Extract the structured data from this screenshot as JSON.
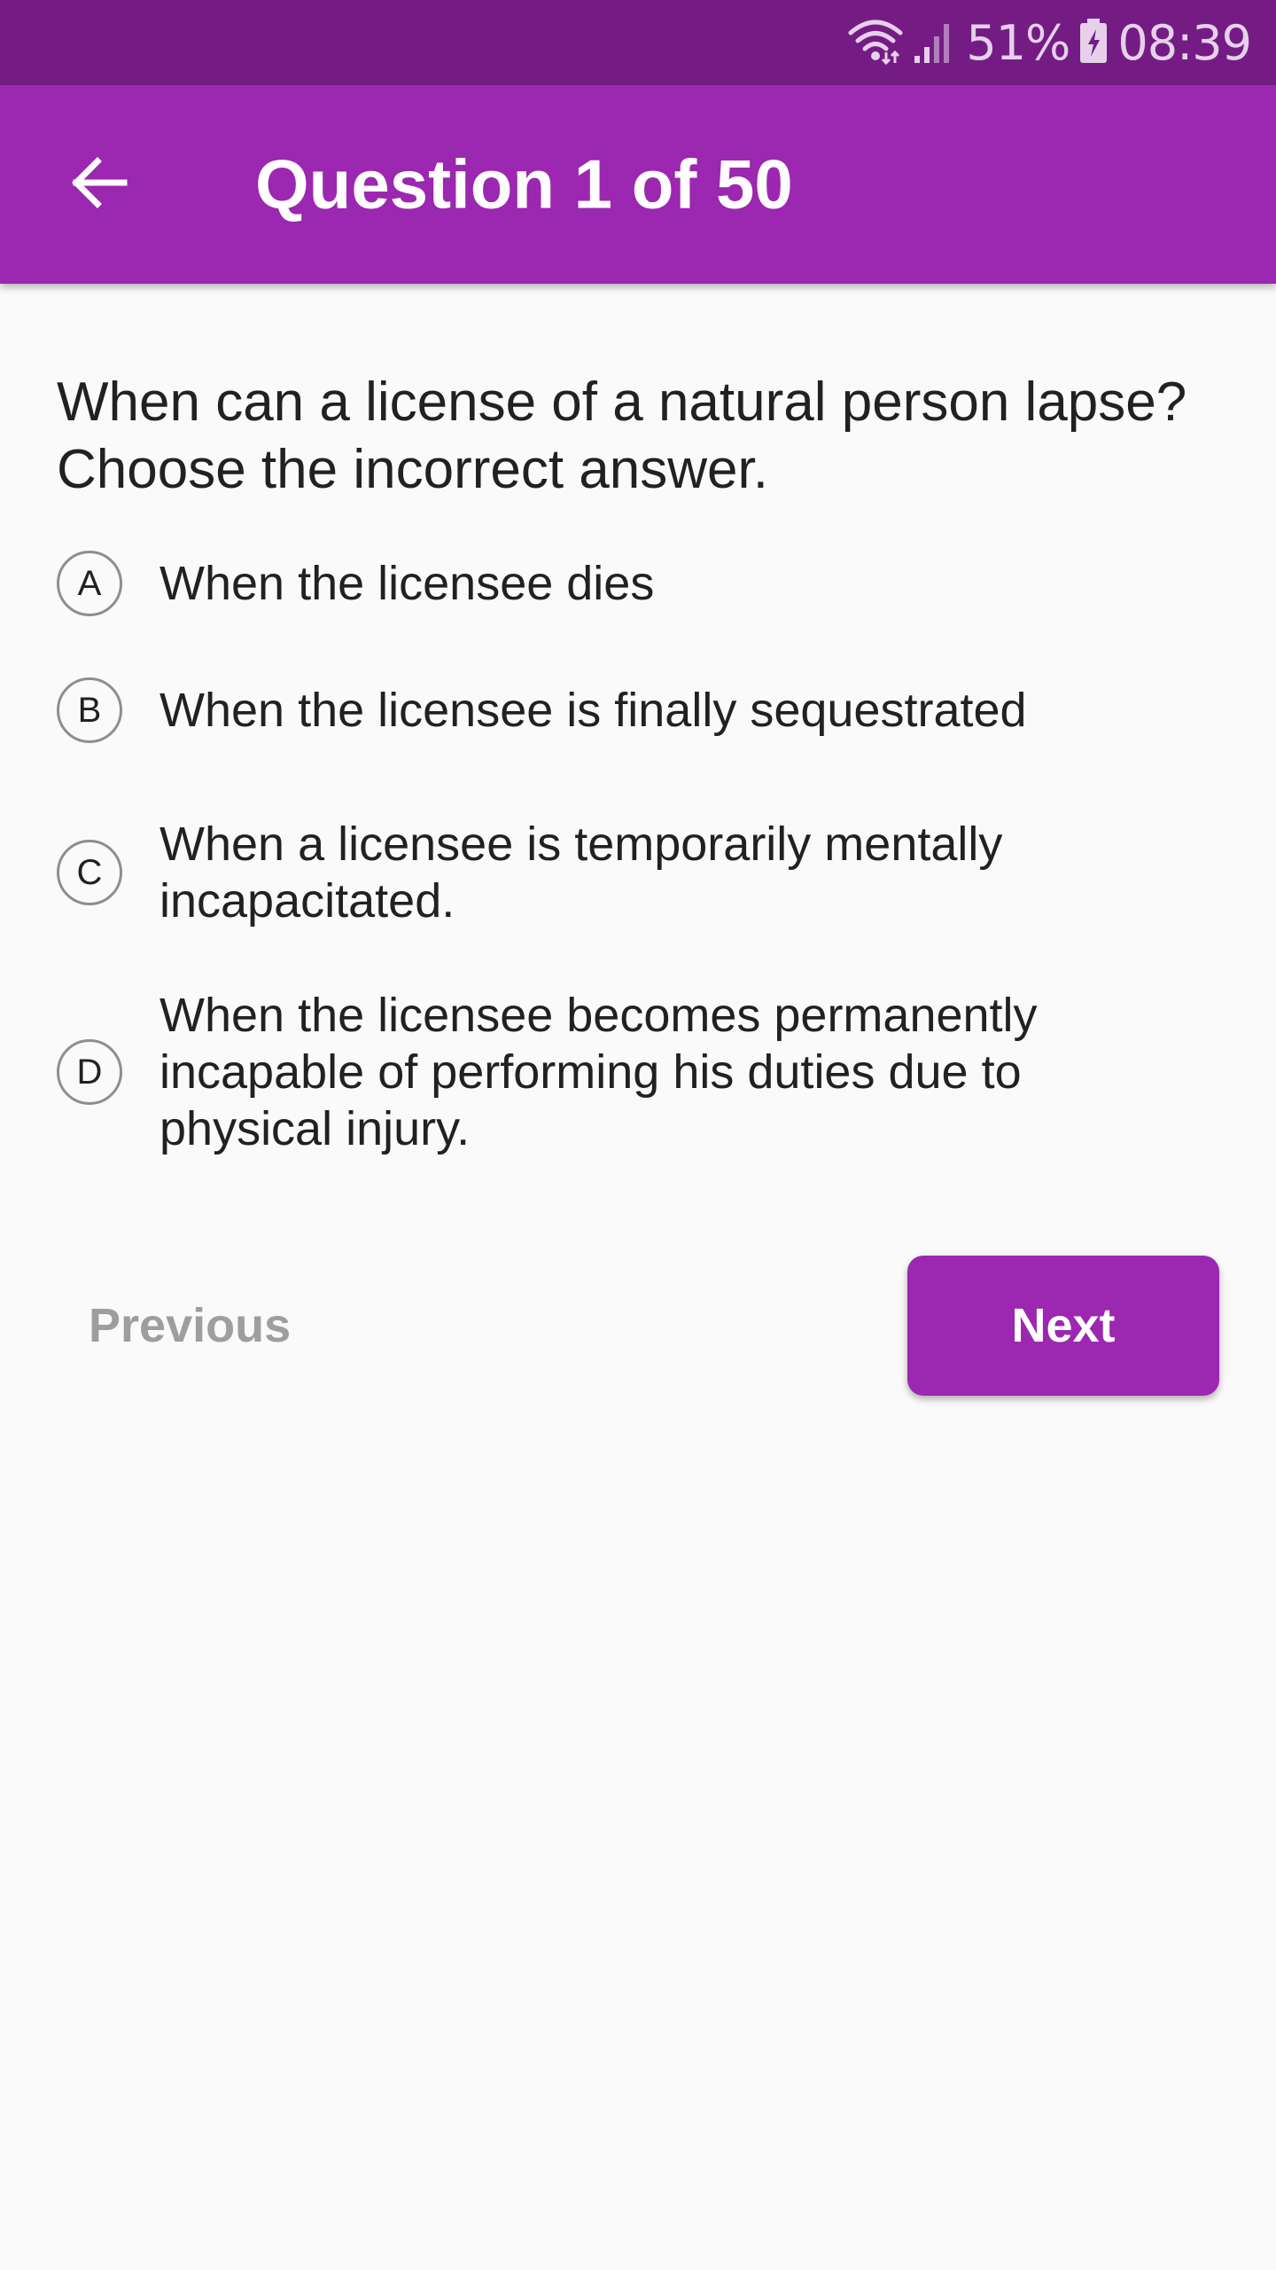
{
  "status_bar": {
    "battery": "51%",
    "time": "08:39",
    "icons": [
      "wifi-icon",
      "signal-icon",
      "battery-icon"
    ]
  },
  "app_bar": {
    "title": "Question 1 of 50",
    "back_icon": "arrow-back-icon"
  },
  "question": {
    "text": "When can a license of a natural person lapse? Choose the incorrect answer."
  },
  "options": [
    {
      "letter": "A",
      "text": "When the licensee dies"
    },
    {
      "letter": "B",
      "text": "When the licensee is finally sequestrated"
    },
    {
      "letter": "C",
      "text": "When a licensee is temporarily mentally incapacitated."
    },
    {
      "letter": "D",
      "text": "When the licensee becomes permanently incapable of performing his duties due to physical injury."
    }
  ],
  "navigation": {
    "previous_label": "Previous",
    "next_label": "Next"
  },
  "colors": {
    "primary": "#9c27b0",
    "primary_dark": "#741c84",
    "background": "#fafafa",
    "disabled_text": "#9e9e9e"
  }
}
